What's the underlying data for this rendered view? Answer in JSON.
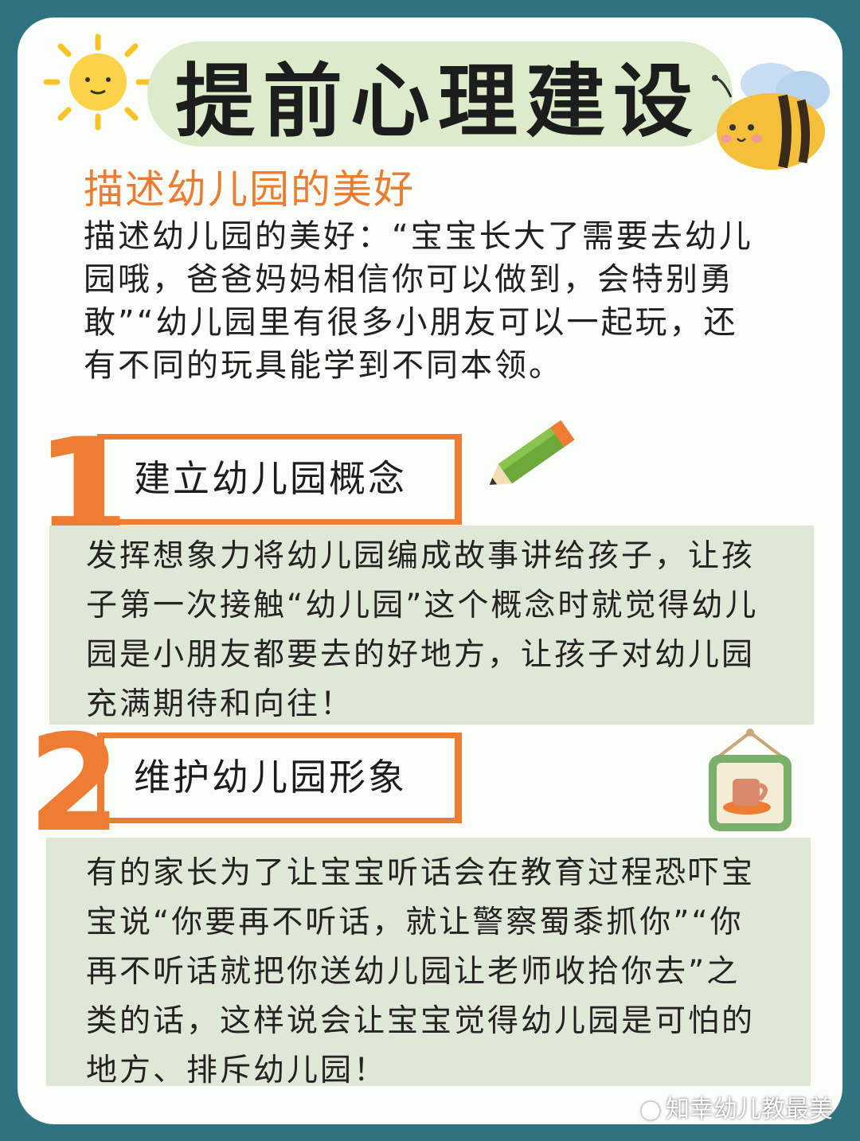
{
  "title": "提前心理建设",
  "subtitle": "描述幼儿园的美好",
  "intro": "描述幼儿园的美好：“宝宝长大了需要去幼儿园哦，爸爸妈妈相信你可以做到，会特别勇敢”“幼儿园里有很多小朋友可以一起玩，还有不同的玩具能学到不同本领。",
  "sections": [
    {
      "number": "1",
      "heading": "建立幼儿园概念",
      "body": "发挥想象力将幼儿园编成故事讲给孩子，让孩子第一次接触“幼儿园”这个概念时就觉得幼儿园是小朋友都要去的好地方，让孩子对幼儿园充满期待和向往！"
    },
    {
      "number": "2",
      "heading": "维护幼儿园形象",
      "body": "有的家长为了让宝宝听话会在教育过程恐吓宝宝说“你要再不听话，就让警察蜀黍抓你”“你再不听话就把你送幼儿园让老师收拾你去”之类的话，这样说会让宝宝觉得幼儿园是可怕的地方、排斥幼儿园！"
    }
  ],
  "watermark": "知幸幼儿教最美",
  "colors": {
    "background": "#2f7381",
    "card": "#fbfdf9",
    "accent_orange": "#ee7c33",
    "panel_green": "#dfe8d6",
    "banner_green": "#dcebc9"
  },
  "icons": [
    "sun-icon",
    "bee-icon",
    "pencil-icon",
    "coffee-frame-icon",
    "wechat-icon"
  ]
}
